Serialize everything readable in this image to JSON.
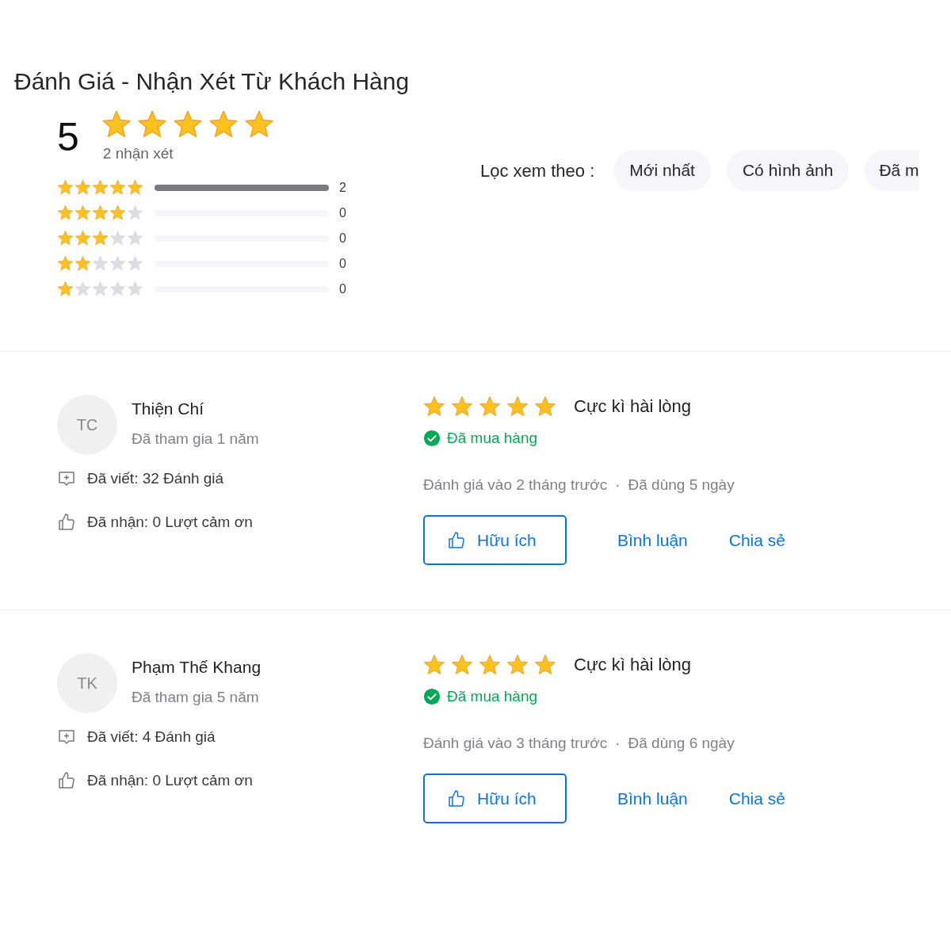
{
  "title": "Đánh Giá - Nhận Xét Từ Khách Hàng",
  "summary": {
    "score": "5",
    "stars": 5,
    "count_text": "2 nhận xét"
  },
  "distribution": [
    {
      "stars": 5,
      "count": "2"
    },
    {
      "stars": 4,
      "count": "0"
    },
    {
      "stars": 3,
      "count": "0"
    },
    {
      "stars": 2,
      "count": "0"
    },
    {
      "stars": 1,
      "count": "0"
    }
  ],
  "filter": {
    "label": "Lọc xem theo :",
    "options": [
      {
        "label": "Mới nhất"
      },
      {
        "label": "Có hình ảnh"
      },
      {
        "label": "Đã m"
      }
    ]
  },
  "reviews": [
    {
      "initials": "TC",
      "name": "Thiện Chí",
      "joined": "Đã tham gia 1 năm",
      "written": "Đã viết: 32 Đánh giá",
      "thanks": "Đã nhận: 0 Lượt cảm ơn",
      "stars": 5,
      "headline": "Cực kì hài lòng",
      "purchased": "Đã mua hàng",
      "date": "Đánh giá vào 2 tháng trước",
      "separator": "·",
      "used": "Đã dùng 5 ngày",
      "actions": [
        "Hữu ích",
        "Bình luận",
        "Chia sẻ"
      ]
    },
    {
      "initials": "TK",
      "name": "Phạm Thế Khang",
      "joined": "Đã tham gia 5 năm",
      "written": "Đã viết: 4 Đánh giá",
      "thanks": "Đã nhận: 0 Lượt cảm ơn",
      "stars": 5,
      "headline": "Cực kì hài lòng",
      "purchased": "Đã mua hàng",
      "date": "Đánh giá vào 3 tháng trước",
      "separator": "·",
      "used": "Đã dùng 6 ngày",
      "actions": [
        "Hữu ích",
        "Bình luận",
        "Chia sẻ"
      ]
    }
  ]
}
